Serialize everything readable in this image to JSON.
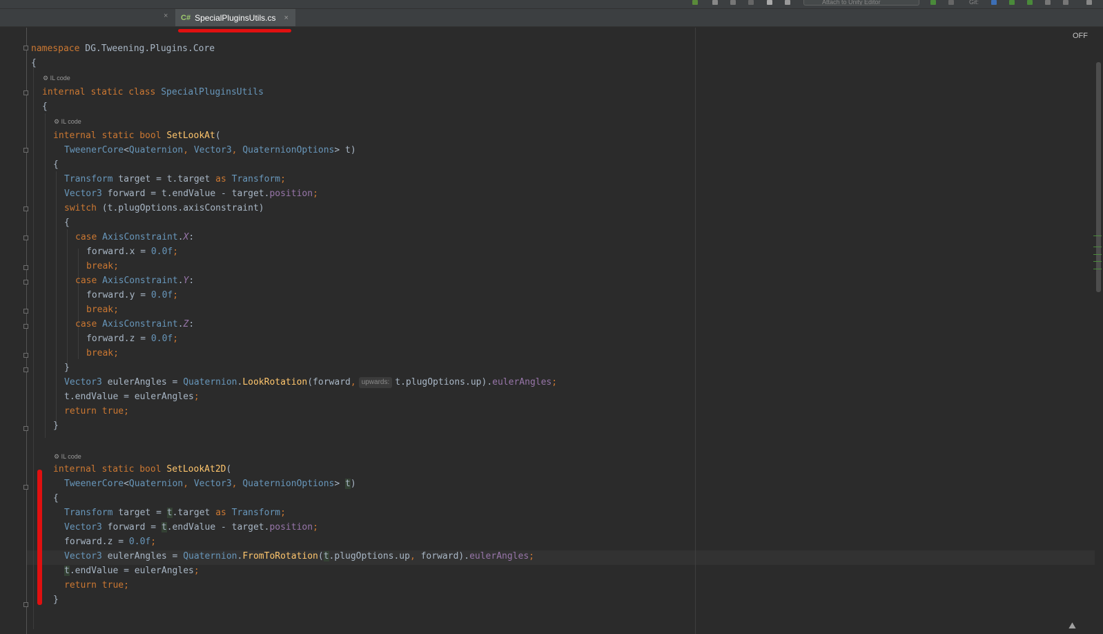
{
  "toolbar": {
    "run_config_label": "Attach to Unity Editor",
    "git_label": "Git:"
  },
  "tabs": {
    "active_lang": "C#",
    "active_title": "SpecialPluginsUtils.cs",
    "close_glyph": "×"
  },
  "editor": {
    "status_off": "OFF",
    "il_code_label": "IL code",
    "param_hint": "upwards:",
    "corner_icon_glyph": "⛰"
  },
  "colors": {
    "background": "#2b2b2b",
    "keyword": "#cc7832",
    "type": "#6897bb",
    "function": "#ffc66d",
    "property": "#9876aa",
    "annotation_red": "#e01010"
  }
}
